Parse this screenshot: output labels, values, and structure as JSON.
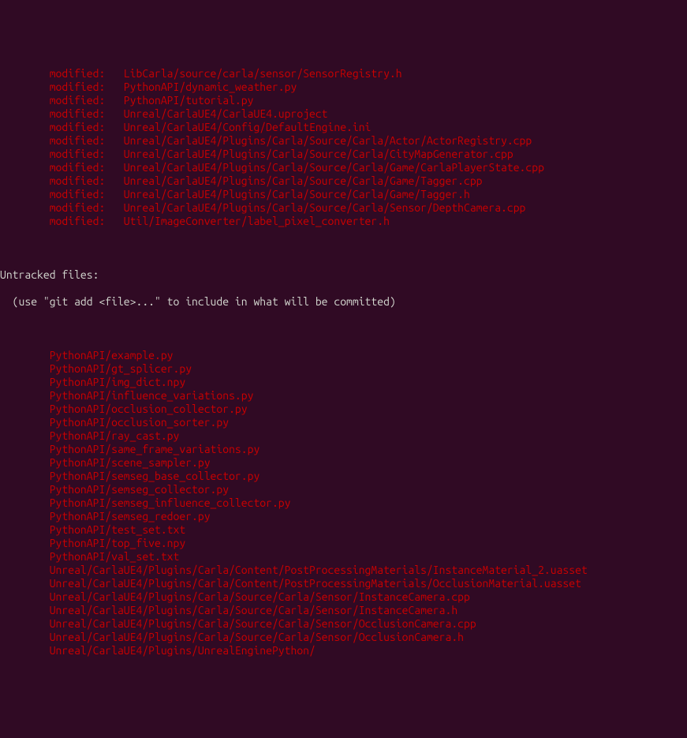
{
  "modified_files": [
    "LibCarla/source/carla/sensor/SensorRegistry.h",
    "PythonAPI/dynamic_weather.py",
    "PythonAPI/tutorial.py",
    "Unreal/CarlaUE4/CarlaUE4.uproject",
    "Unreal/CarlaUE4/Config/DefaultEngine.ini",
    "Unreal/CarlaUE4/Plugins/Carla/Source/Carla/Actor/ActorRegistry.cpp",
    "Unreal/CarlaUE4/Plugins/Carla/Source/Carla/CityMapGenerator.cpp",
    "Unreal/CarlaUE4/Plugins/Carla/Source/Carla/Game/CarlaPlayerState.cpp",
    "Unreal/CarlaUE4/Plugins/Carla/Source/Carla/Game/Tagger.cpp",
    "Unreal/CarlaUE4/Plugins/Carla/Source/Carla/Game/Tagger.h",
    "Unreal/CarlaUE4/Plugins/Carla/Source/Carla/Sensor/DepthCamera.cpp",
    "Util/ImageConverter/label_pixel_converter.h"
  ],
  "modified_label": "modified:   ",
  "untracked_header": "Untracked files:",
  "untracked_hint": "  (use \"git add <file>...\" to include in what will be committed)",
  "untracked_files": [
    "PythonAPI/example.py",
    "PythonAPI/gt_splicer.py",
    "PythonAPI/img_dict.npy",
    "PythonAPI/influence_variations.py",
    "PythonAPI/occlusion_collector.py",
    "PythonAPI/occlusion_sorter.py",
    "PythonAPI/ray_cast.py",
    "PythonAPI/same_frame_variations.py",
    "PythonAPI/scene_sampler.py",
    "PythonAPI/semseg_base_collector.py",
    "PythonAPI/semseg_collector.py",
    "PythonAPI/semseg_influence_collector.py",
    "PythonAPI/semseg_redoer.py",
    "PythonAPI/test_set.txt",
    "PythonAPI/top_five.npy",
    "PythonAPI/val_set.txt",
    "Unreal/CarlaUE4/Plugins/Carla/Content/PostProcessingMaterials/InstanceMaterial_2.uasset",
    "Unreal/CarlaUE4/Plugins/Carla/Content/PostProcessingMaterials/OcclusionMaterial.uasset",
    "Unreal/CarlaUE4/Plugins/Carla/Source/Carla/Sensor/InstanceCamera.cpp",
    "Unreal/CarlaUE4/Plugins/Carla/Source/Carla/Sensor/InstanceCamera.h",
    "Unreal/CarlaUE4/Plugins/Carla/Source/Carla/Sensor/OcclusionCamera.cpp",
    "Unreal/CarlaUE4/Plugins/Carla/Source/Carla/Sensor/OcclusionCamera.h",
    "Unreal/CarlaUE4/Plugins/UnrealEnginePython/"
  ]
}
